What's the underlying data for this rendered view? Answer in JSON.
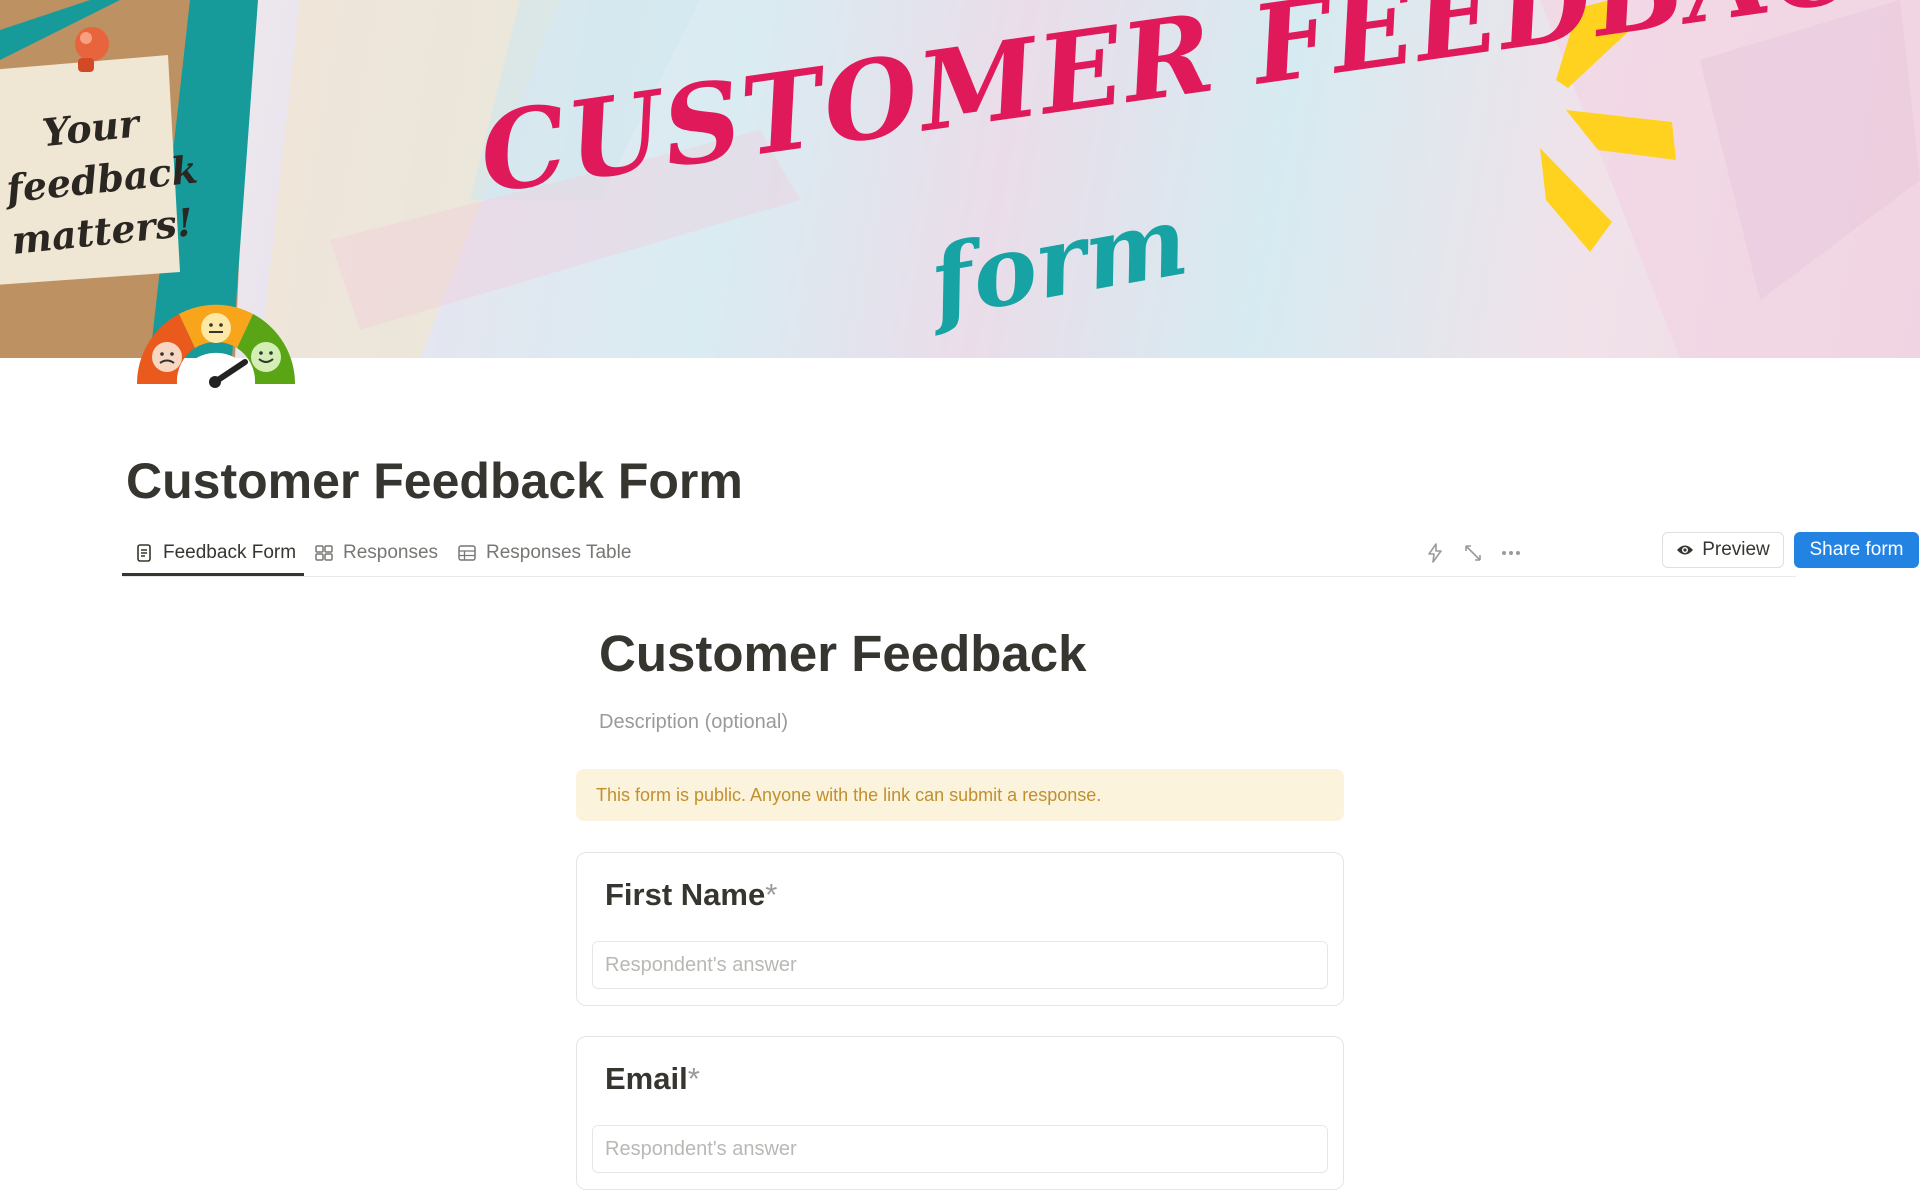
{
  "cover": {
    "title": "CUSTOMER FEEDBACK",
    "subtitle": "form",
    "note_lines": [
      "Your",
      "feedback",
      "matters!"
    ],
    "colors": {
      "title": "#e0195b",
      "subtitle": "#17a2a3",
      "teal_band": "#179a9a",
      "sparkle": "#ffd21f"
    }
  },
  "page_icon": "satisfaction-gauge-icon",
  "page": {
    "title": "Customer Feedback Form"
  },
  "tabs": [
    {
      "label": "Feedback Form",
      "icon": "document-icon",
      "active": true
    },
    {
      "label": "Responses",
      "icon": "gallery-icon",
      "active": false
    },
    {
      "label": "Responses Table",
      "icon": "table-icon",
      "active": false
    }
  ],
  "toolbar": {
    "icons": [
      "lightning-icon",
      "expand-icon",
      "more-icon"
    ],
    "preview_label": "Preview",
    "share_label": "Share form",
    "share_color": "#2383e2"
  },
  "form": {
    "title": "Customer Feedback",
    "description_placeholder": "Description (optional)",
    "notice": "This form is public. Anyone with the link can submit a response.",
    "questions": [
      {
        "label": "First Name",
        "required_mark": "*",
        "placeholder": "Respondent's answer"
      },
      {
        "label": "Email",
        "required_mark": "*",
        "placeholder": "Respondent's answer"
      }
    ]
  }
}
